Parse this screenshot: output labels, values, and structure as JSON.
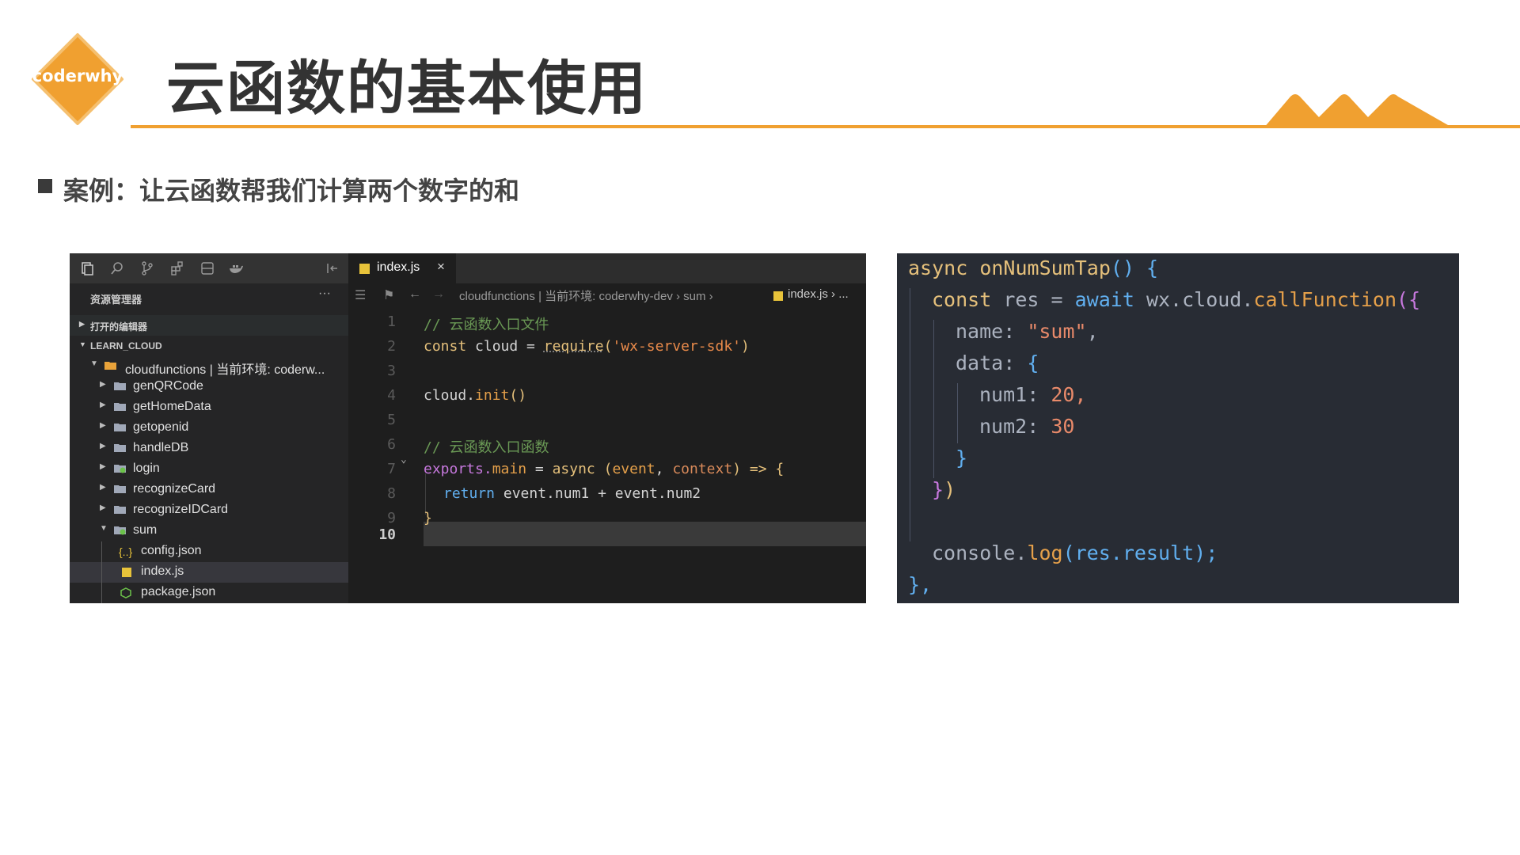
{
  "logo": {
    "text": "coderwhy",
    "color": "#F0A030"
  },
  "slide": {
    "title": "云函数的基本使用",
    "bullet": "案例：让云函数帮我们计算两个数字的和",
    "accent": "#F0A030"
  },
  "editor": {
    "activity_icons": [
      "files-icon",
      "search-icon",
      "source-control-icon",
      "extensions-icon",
      "remote-icon",
      "docker-icon"
    ],
    "explorer_title": "资源管理器",
    "explorer_more": "···",
    "open_editors": "打开的编辑器",
    "project": "LEARN_CLOUD",
    "tree": [
      {
        "label": "cloudfunctions | 当前环境: coderw...",
        "type": "folder-open-cloud"
      },
      {
        "label": "genQRCode",
        "type": "folder"
      },
      {
        "label": "getHomeData",
        "type": "folder"
      },
      {
        "label": "getopenid",
        "type": "folder"
      },
      {
        "label": "handleDB",
        "type": "folder"
      },
      {
        "label": "login",
        "type": "folder-cloud"
      },
      {
        "label": "recognizeCard",
        "type": "folder"
      },
      {
        "label": "recognizeIDCard",
        "type": "folder"
      },
      {
        "label": "sum",
        "type": "folder-open-cloud"
      },
      {
        "label": "config.json",
        "type": "json"
      },
      {
        "label": "index.js",
        "type": "js"
      },
      {
        "label": "package.json",
        "type": "npm"
      }
    ],
    "tab": {
      "label": "index.js",
      "close": "×"
    },
    "breadcrumb": {
      "path": "cloudfunctions | 当前环境: coderwhy-dev › sum ›",
      "file": "index.js › ..."
    },
    "line_numbers": [
      "1",
      "2",
      "3",
      "4",
      "5",
      "6",
      "7",
      "8",
      "9",
      "10"
    ],
    "code": {
      "l1": "// 云函数入口文件",
      "l2_kw": "const",
      "l2_rest": " cloud = ",
      "l2_fn": "require",
      "l2_str": "'wx-server-sdk'",
      "l4_obj": "cloud.",
      "l4_fn": "init",
      "l6": "// 云函数入口函数",
      "l7_obj": "exports.",
      "l7_prop": "main",
      "l7_mid": " = ",
      "l7_async": "async",
      "l7_p1": "event",
      "l7_p2": "context",
      "l7_arrow": " => {",
      "l8_kw": "return",
      "l8_rest": " event.num1 + event.num2",
      "l9": "}"
    }
  },
  "snippet": {
    "l1_async": "async",
    "l1_fn": "onNumSumTap",
    "l1_rest": "() {",
    "l2_const": "const",
    "l2_res": " res = ",
    "l2_await": "await",
    "l2_obj": " wx.cloud.",
    "l2_fn": "callFunction",
    "l2_paren": "({",
    "l3_key": "name:",
    "l3_val": "\"sum\"",
    "l4_key": "data:",
    "l4_brace": "{",
    "l5_key": "num1:",
    "l5_val": "20,",
    "l6_key": "num2:",
    "l6_val": "30",
    "l7": "}",
    "l8_brace": "}",
    "l8_paren": ")",
    "l10_obj": "console.",
    "l10_fn": "log",
    "l10_rest": "(res.result);",
    "l11": "},"
  }
}
